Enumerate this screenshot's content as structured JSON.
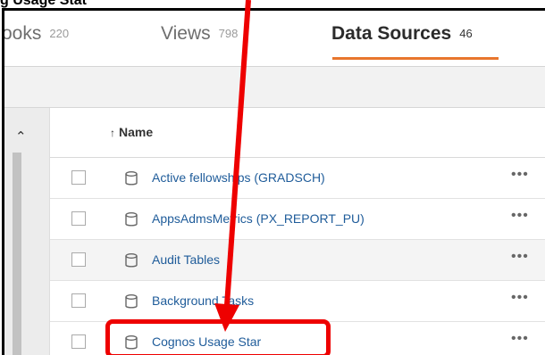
{
  "header_label": "g Usage Stat",
  "tabs": [
    {
      "label": "ooks",
      "count": "220"
    },
    {
      "label": "Views",
      "count": "798"
    },
    {
      "label": "Data Sources",
      "count": "46"
    }
  ],
  "table": {
    "sort_indicator": "↑",
    "column_name": "Name",
    "rows": [
      {
        "label": "Active fellowships (GRADSCH)"
      },
      {
        "label": "AppsAdmsMetrics (PX_REPORT_PU)"
      },
      {
        "label": "Audit Tables"
      },
      {
        "label": "Background Tasks"
      },
      {
        "label": "Cognos Usage Star"
      }
    ],
    "more_glyph": "•••"
  },
  "scroll": {
    "up_glyph": "⌃"
  },
  "colors": {
    "accent_tab": "#e8762d",
    "link": "#1f5c9a",
    "annotation": "#ee0000"
  },
  "icons": {
    "data_source": "database-icon",
    "more": "more-options-icon",
    "sort": "sort-ascending-icon"
  }
}
